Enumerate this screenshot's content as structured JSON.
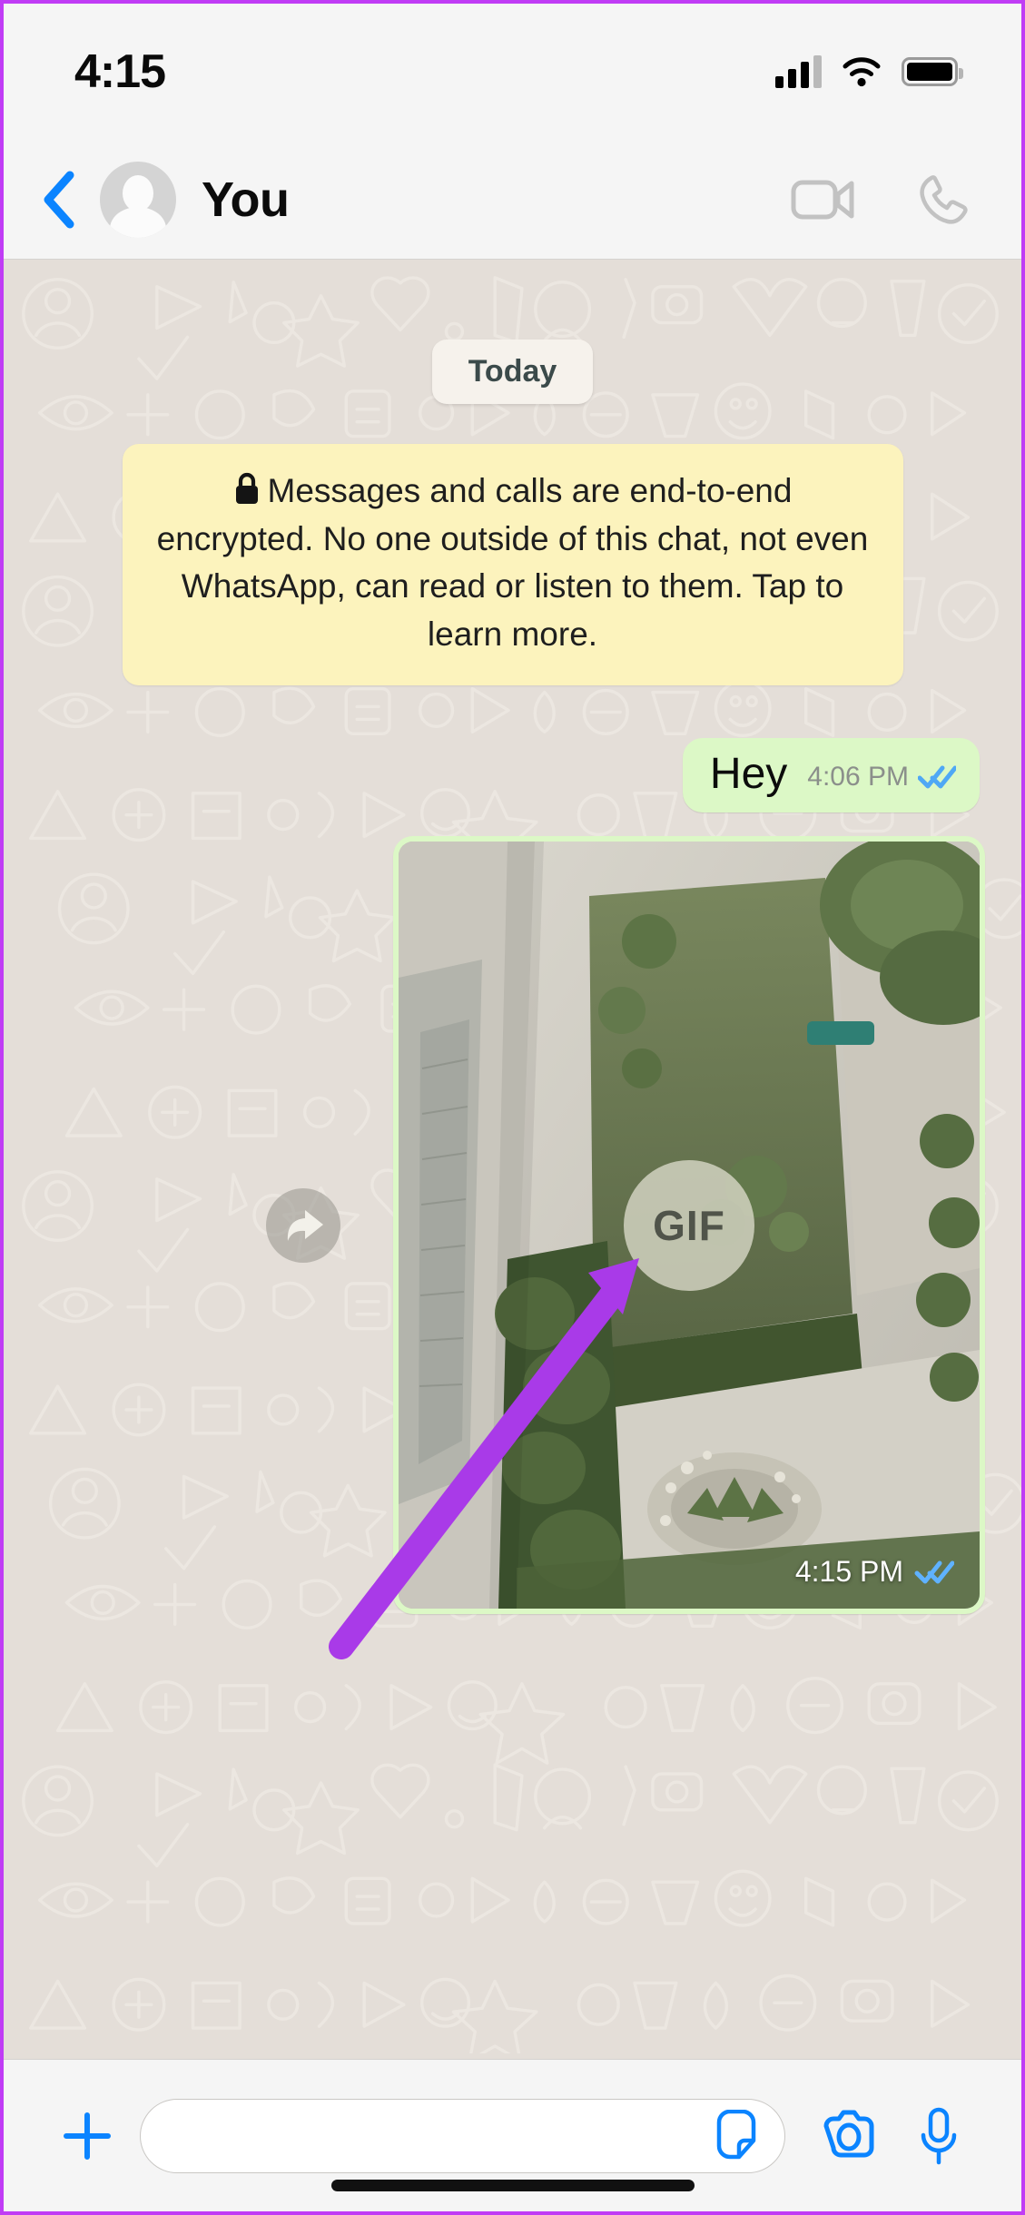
{
  "status_bar": {
    "time": "4:15",
    "signal_icon": "cellular-signal-icon",
    "wifi_icon": "wifi-icon",
    "battery_icon": "battery-icon"
  },
  "header": {
    "back_icon": "back-chevron-icon",
    "avatar_icon": "contact-avatar",
    "title": "You",
    "video_call_icon": "video-call-icon",
    "voice_call_icon": "phone-call-icon"
  },
  "chat": {
    "day_divider": "Today",
    "encryption_notice": {
      "lock_icon": "lock-icon",
      "text": "Messages and calls are end-to-end encrypted. No one outside of this chat, not even WhatsApp, can read or listen to them. Tap to learn more."
    },
    "messages": [
      {
        "type": "text",
        "text": "Hey",
        "time": "4:06 PM",
        "status_icon": "double-check-blue",
        "outgoing": true
      },
      {
        "type": "media",
        "badge": "GIF",
        "time": "4:15 PM",
        "status_icon": "double-check-blue",
        "forward_icon": "forward-arrow-icon",
        "outgoing": true
      }
    ]
  },
  "input_bar": {
    "add_icon": "plus-icon",
    "placeholder": "",
    "value": "",
    "sticker_icon": "sticker-icon",
    "camera_icon": "camera-icon",
    "mic_icon": "microphone-icon"
  },
  "annotation": {
    "arrow_icon": "purple-arrow-annotation",
    "color": "#a93ae8"
  },
  "colors": {
    "accent_blue": "#0b84ff",
    "outgoing_bubble": "#dcf8c6",
    "notice_bg": "#fcf3bd",
    "chat_bg": "#e4ded8",
    "bar_bg": "#f5f5f5",
    "frame_border": "#c03cf5"
  }
}
